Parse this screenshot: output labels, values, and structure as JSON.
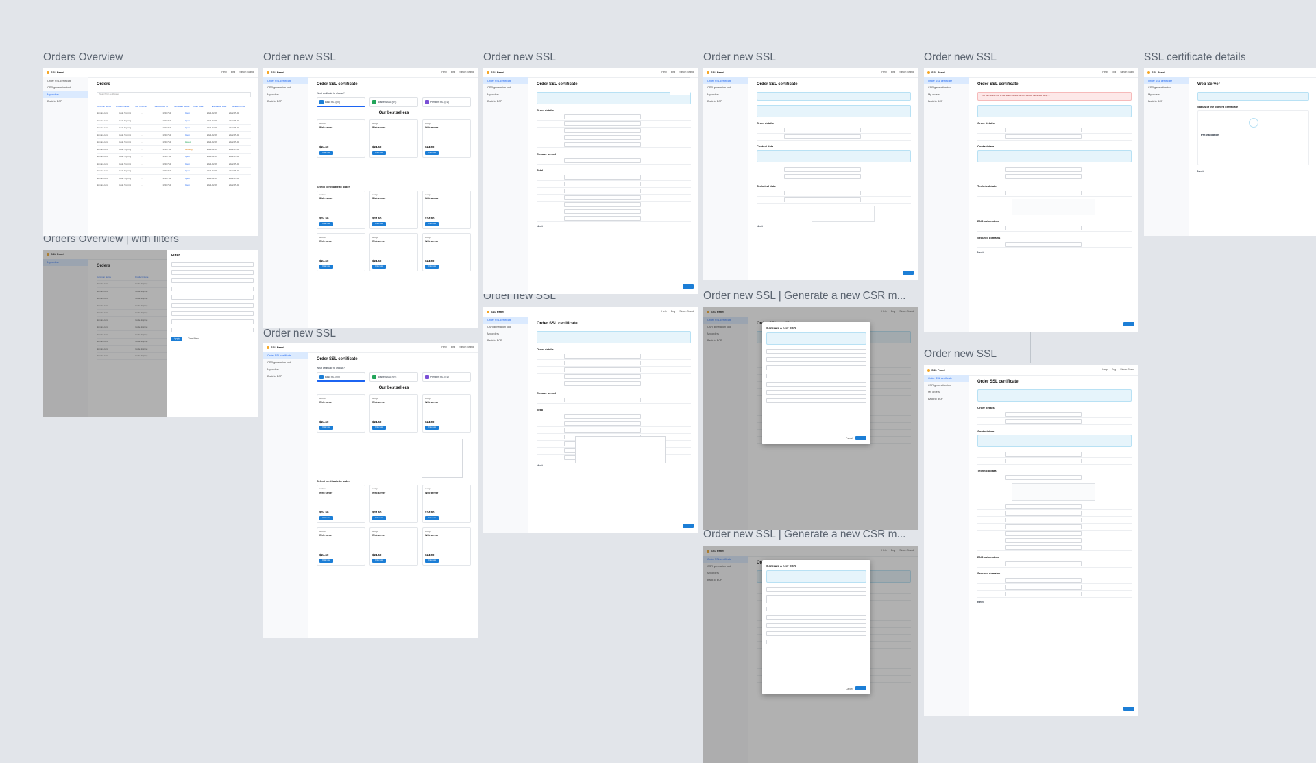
{
  "frames": {
    "orders_overview": "Orders Overview",
    "orders_overview_filters": "Orders Overview | with filters",
    "order_new_ssl": "Order new SSL",
    "generate_csr": "Order new SSL | Generate a new CSR m...",
    "ssl_details": "SSL certificate details"
  },
  "app": {
    "logo": "SSL Panel",
    "help": "Help",
    "lang": "Eng",
    "user": "Simon Brand"
  },
  "sidebar": {
    "order_certificate": "Order SSL certificate",
    "csr_generation": "CSR generation tool",
    "my_orders": "My orders",
    "back": "Back to BCP"
  },
  "orders": {
    "title": "Orders",
    "search_placeholder": "Search for certificates",
    "columns": [
      "Common Name",
      "Product Name",
      "Our Order ID",
      "Sales Order ID",
      "Certificate Status",
      "Order Date",
      "Expiration Date",
      "Renewal Price"
    ],
    "rows": [
      [
        "domain.com",
        "Code Signing",
        "...",
        "1234754",
        "Open",
        "2021-02-03",
        "2022-05-02"
      ],
      [
        "domain.com",
        "Code Signing",
        "...",
        "1234754",
        "Open",
        "2021-02-03",
        "2022-05-02"
      ],
      [
        "domain.com",
        "Code Signing",
        "...",
        "1234754",
        "Open",
        "2021-02-03",
        "2022-05-02"
      ],
      [
        "domain.com",
        "Code Signing",
        "...",
        "1234754",
        "Open",
        "2021-02-03",
        "2022-05-02"
      ],
      [
        "domain.com",
        "Code Signing",
        "...",
        "1234754",
        "Issued",
        "2021-02-03",
        "2022-05-02"
      ],
      [
        "domain.com",
        "Code Signing",
        "...",
        "1234754",
        "Pending",
        "2021-02-03",
        "2022-05-02"
      ],
      [
        "domain.com",
        "Code Signing",
        "...",
        "1234754",
        "Open",
        "2021-02-03",
        "2022-05-02"
      ],
      [
        "domain.com",
        "Code Signing",
        "...",
        "1234754",
        "Open",
        "2021-02-03",
        "2022-05-02"
      ],
      [
        "domain.com",
        "Code Signing",
        "...",
        "1234754",
        "Open",
        "2021-02-03",
        "2022-05-02"
      ],
      [
        "domain.com",
        "Code Signing",
        "...",
        "1234754",
        "Open",
        "2021-02-03",
        "2022-05-02"
      ],
      [
        "domain.com",
        "Code Signing",
        "...",
        "1234754",
        "Open",
        "2021-02-03",
        "2022-05-02"
      ]
    ],
    "filter_title": "Filter",
    "apply": "Apply",
    "clear": "Clear filters"
  },
  "order": {
    "title": "Order SSL certificate",
    "which": "What certificate to choose?",
    "tabs": [
      "Basic SSL (DV)",
      "Business SSL (OV)",
      "Premium SSL (EV)"
    ],
    "bestsellers": "Our bestsellers",
    "select_heading": "Select certificate to order",
    "card_brand": "sectigo",
    "card_name": "Web server",
    "card_price": "$24.50",
    "card_button": "Order now",
    "order_details": "Order details",
    "choose_period": "Choose period",
    "total": "Total",
    "contact_data": "Contact data",
    "technical_data": "Technical data",
    "dns_automation": "DNS automation",
    "secured_domains": "Secured domains",
    "next": "Next",
    "error_text": "You can renew now in the Select Details section without the renew being ..."
  },
  "csr": {
    "title": "Generate a new CSR",
    "generate": "Generate",
    "cancel": "Cancel"
  },
  "details": {
    "title": "Web Server",
    "status_heading": "Status of the current certificate",
    "pre_validation": "Pre-validation"
  }
}
